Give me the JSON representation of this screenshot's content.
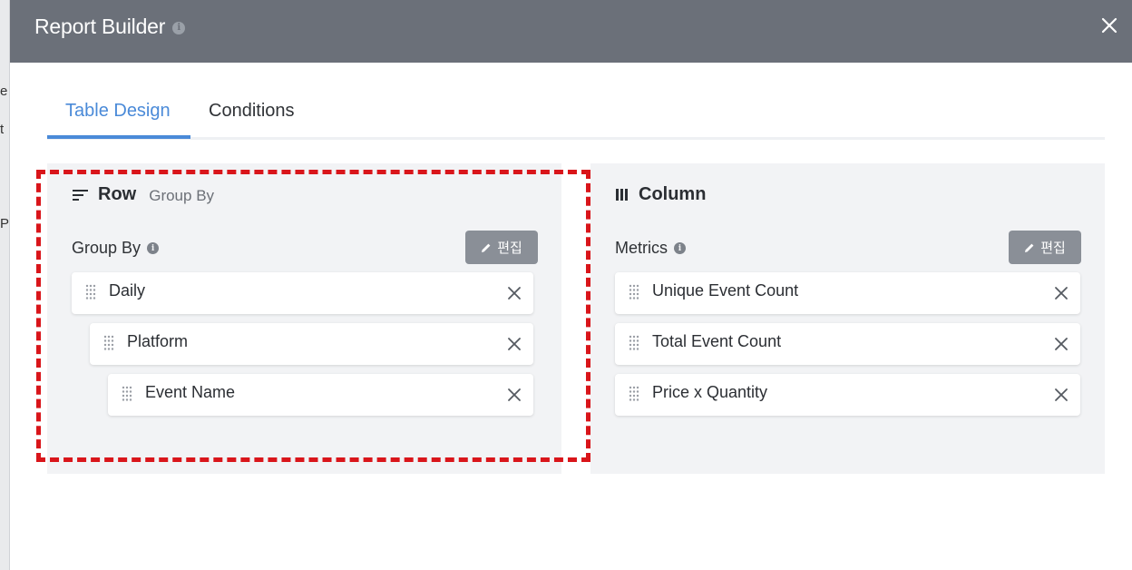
{
  "backdrop": {
    "peek_texts": [
      "e",
      "t",
      "Pr"
    ]
  },
  "modal": {
    "title": "Report Builder",
    "title_info": "i"
  },
  "tabs": [
    {
      "label": "Table Design",
      "active": true
    },
    {
      "label": "Conditions",
      "active": false
    }
  ],
  "row_panel": {
    "title": "Row",
    "subtitle": "Group By",
    "section_label": "Group By",
    "section_info": "i",
    "edit_label": "편집",
    "items": [
      {
        "label": "Daily"
      },
      {
        "label": "Platform"
      },
      {
        "label": "Event Name"
      }
    ]
  },
  "column_panel": {
    "title": "Column",
    "section_label": "Metrics",
    "section_info": "i",
    "edit_label": "편집",
    "items": [
      {
        "label": "Unique Event Count"
      },
      {
        "label": "Total Event Count"
      },
      {
        "label": "Price x Quantity"
      }
    ]
  },
  "colors": {
    "header": "#6b7079",
    "accent": "#4a8ad8",
    "highlight": "#d9151a",
    "panel_bg": "#f2f3f5",
    "edit_button": "#8a8f97"
  },
  "icons": {
    "row_icon": "sort-lines-icon",
    "column_icon": "columns-bars-icon",
    "grip_icon": "drag-grip-icon",
    "remove_icon": "close-icon",
    "edit_icon": "pencil-icon"
  }
}
